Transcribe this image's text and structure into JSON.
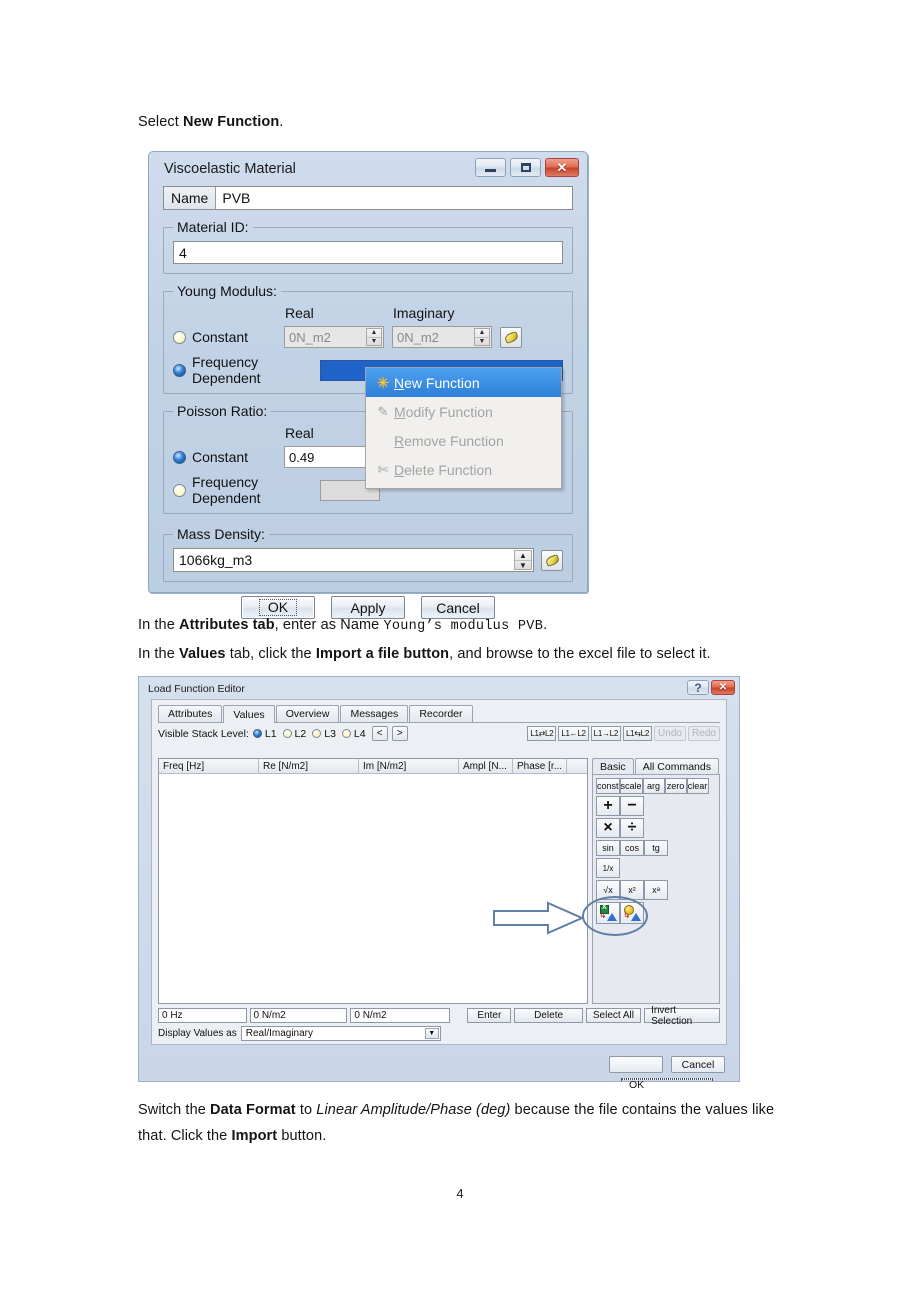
{
  "page": {
    "number": "4",
    "intro_pre": "Select ",
    "intro_bold": "New Function",
    "intro_post": ".",
    "para2_pre": "In the ",
    "para2_b1": "Attributes tab",
    "para2_mid": ", enter as Name ",
    "para2_mono": "Young’s modulus PVB",
    "para2_post": ".",
    "para3_pre": "In the ",
    "para3_b1": "Values",
    "para3_mid": " tab, click the ",
    "para3_b2": "Import a file button",
    "para3_post": ", and browse to the excel file to select it.",
    "para4_pre": "Switch the ",
    "para4_b1": "Data Format",
    "para4_mid": " to ",
    "para4_i1": "Linear Amplitude/Phase (deg)",
    "para4_post": " because the file contains the values like that. Click the ",
    "para4_b2": "Import",
    "para4_end": " button."
  },
  "dialog1": {
    "title": "Viscoelastic Material",
    "buttons": {
      "minimize": "minimize-icon",
      "maximize": "maximize-icon",
      "close": "close-icon"
    },
    "name_label": "Name",
    "name_value": "PVB",
    "material_id_legend": "Material ID:",
    "material_id_value": "4",
    "young_legend": "Young Modulus:",
    "col_real": "Real",
    "col_imaginary": "Imaginary",
    "young_constant_label": "Constant",
    "young_const_real": "0N_m2",
    "young_const_imag": "0N_m2",
    "young_freq_label": "Frequency Dependent",
    "poisson_legend": "Poisson Ratio:",
    "poisson_col_real": "Real",
    "poisson_constant_label": "Constant",
    "poisson_const_real": "0.49",
    "poisson_freq_label": "Frequency Dependent",
    "mass_legend": "Mass Density:",
    "mass_value": "1066kg_m3",
    "ok": "OK",
    "apply": "Apply",
    "cancel": "Cancel"
  },
  "context_menu": {
    "items": [
      {
        "label": "New Function",
        "mnemonic": "N",
        "icon": "new-star-icon",
        "enabled": true,
        "highlighted": true
      },
      {
        "label": "Modify Function",
        "mnemonic": "M",
        "icon": "modify-icon",
        "enabled": false,
        "highlighted": false
      },
      {
        "label": "Remove Function",
        "mnemonic": "R",
        "icon": "",
        "enabled": false,
        "highlighted": false
      },
      {
        "label": "Delete Function",
        "mnemonic": "D",
        "icon": "scissors-icon",
        "enabled": false,
        "highlighted": false
      }
    ]
  },
  "dialog2": {
    "title": "Load Function Editor",
    "help_btn": "help-icon",
    "close_btn": "close-icon",
    "tabs": [
      {
        "label": "Attributes",
        "active": false
      },
      {
        "label": "Values",
        "active": true
      },
      {
        "label": "Overview",
        "active": false
      },
      {
        "label": "Messages",
        "active": false
      },
      {
        "label": "Recorder",
        "active": false
      }
    ],
    "stack_label": "Visible Stack Level:",
    "stack_levels": [
      {
        "label": "L1",
        "selected": true
      },
      {
        "label": "L2",
        "selected": false
      },
      {
        "label": "L3",
        "selected": false
      },
      {
        "label": "L4",
        "selected": false
      }
    ],
    "nav_prev": "<",
    "nav_next": ">",
    "stack_ops": [
      "L1⇄L2",
      "L1←L2",
      "L1→L2",
      "L1⇆L2"
    ],
    "undo": "Undo",
    "redo": "Redo",
    "table_headers": [
      "Freq [Hz]",
      "Re [N/m2]",
      "Im [N/m2]",
      "Ampl [N...",
      "Phase [r...",
      ""
    ],
    "table_rows": [],
    "calc_tabs": [
      {
        "label": "Basic",
        "active": true
      },
      {
        "label": "All Commands",
        "active": false
      }
    ],
    "calc_buttons_row1": [
      "const",
      "scale",
      "arg",
      "zero",
      "clear"
    ],
    "calc_buttons_row2": [
      "+",
      "−"
    ],
    "calc_buttons_row3": [
      "×",
      "÷"
    ],
    "calc_buttons_row4": [
      "sin",
      "cos",
      "tg"
    ],
    "calc_buttons_row5": [
      "1/x"
    ],
    "calc_buttons_row6": [
      "√x",
      "x²",
      "xᵃ"
    ],
    "calc_buttons_row7": [
      "import-excel-file-icon",
      "import-function-icon"
    ],
    "bottom_inputs": [
      "0 Hz",
      "0 N/m2",
      "0 N/m2"
    ],
    "bottom_buttons": [
      "Enter",
      "Delete",
      "Select All",
      "Invert Selection"
    ],
    "display_values_label": "Display Values as",
    "display_values_value": "Real/Imaginary",
    "footer_ok": "OK",
    "footer_cancel": "Cancel"
  },
  "annotation": {
    "arrow": "callout-arrow",
    "ellipse": "callout-ellipse",
    "color": "#5f7fa6"
  }
}
